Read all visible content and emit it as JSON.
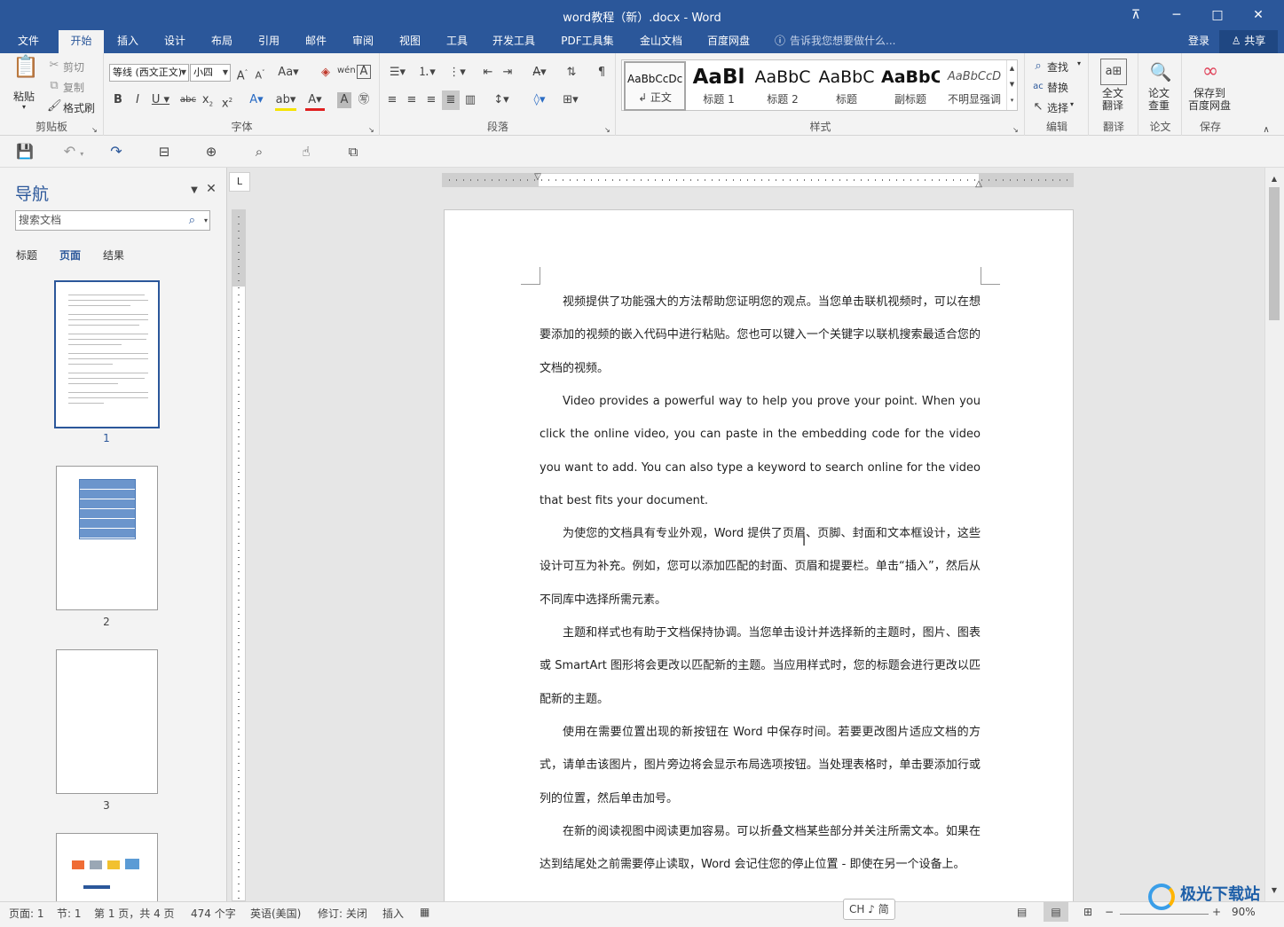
{
  "titlebar": {
    "title": "word教程（新）.docx - Word"
  },
  "menu": {
    "tabs": [
      "文件",
      "开始",
      "插入",
      "设计",
      "布局",
      "引用",
      "邮件",
      "审阅",
      "视图",
      "工具",
      "开发工具",
      "PDF工具集",
      "金山文档",
      "百度网盘"
    ],
    "tell_me": "告诉我您想要做什么...",
    "login": "登录",
    "share": "共享"
  },
  "clipboard": {
    "paste": "粘贴",
    "cut": "剪切",
    "copy": "复制",
    "format_painter": "格式刷",
    "label": "剪贴板"
  },
  "font": {
    "name": "等线 (西文正文)",
    "size": "小四",
    "label": "字体"
  },
  "paragraph": {
    "label": "段落"
  },
  "styles": {
    "label": "样式",
    "items": [
      {
        "preview": "AaBbCcDc",
        "name": "↲ 正文"
      },
      {
        "preview": "AaBl",
        "name": "标题 1"
      },
      {
        "preview": "AaBbC",
        "name": "标题 2"
      },
      {
        "preview": "AaBbC",
        "name": "标题"
      },
      {
        "preview": "AaBbC",
        "name": "副标题"
      },
      {
        "preview": "AaBbCcD",
        "name": "不明显强调"
      }
    ]
  },
  "editing": {
    "find": "查找",
    "replace": "替换",
    "select": "选择",
    "label": "编辑"
  },
  "translate": {
    "btn": "全文\n翻译",
    "label": "翻译"
  },
  "paper": {
    "btn": "论文\n查重",
    "label": "论文"
  },
  "save_cloud": {
    "btn": "保存到\n百度网盘",
    "label": "保存"
  },
  "nav": {
    "title": "导航",
    "search_placeholder": "搜索文档",
    "tabs": [
      "标题",
      "页面",
      "结果"
    ],
    "pages": [
      "1",
      "2",
      "3"
    ]
  },
  "document": {
    "paragraphs": [
      "视频提供了功能强大的方法帮助您证明您的观点。当您单击联机视频时，可以在想要添加的视频的嵌入代码中进行粘贴。您也可以键入一个关键字以联机搜索最适合您的文档的视频。",
      "Video provides a powerful way to help you prove your point. When you click the online video, you can paste in the embedding code for the video you want to add. You can also type a keyword to search online for the video that best fits your document.",
      "为使您的文档具有专业外观，Word 提供了页眉、页脚、封面和文本框设计，这些设计可互为补充。例如，您可以添加匹配的封面、页眉和提要栏。单击“插入”，然后从不同库中选择所需元素。",
      "主题和样式也有助于文档保持协调。当您单击设计并选择新的主题时，图片、图表或 SmartArt 图形将会更改以匹配新的主题。当应用样式时，您的标题会进行更改以匹配新的主题。",
      "使用在需要位置出现的新按钮在 Word 中保存时间。若要更改图片适应文档的方式，请单击该图片，图片旁边将会显示布局选项按钮。当处理表格时，单击要添加行或列的位置，然后单击加号。",
      "在新的阅读视图中阅读更加容易。可以折叠文档某些部分并关注所需文本。如果在达到结尾处之前需要停止读取，Word 会记住您的停止位置 - 即使在另一个设备上。"
    ]
  },
  "status": {
    "page": "页面: 1",
    "section": "节: 1",
    "page_of": "第 1 页，共 4 页",
    "words": "474 个字",
    "lang": "英语(美国)",
    "track": "修订: 关闭",
    "insert": "插入",
    "ime": "CH ♪ 简",
    "zoom": "90%"
  },
  "watermark": "极光下载站"
}
